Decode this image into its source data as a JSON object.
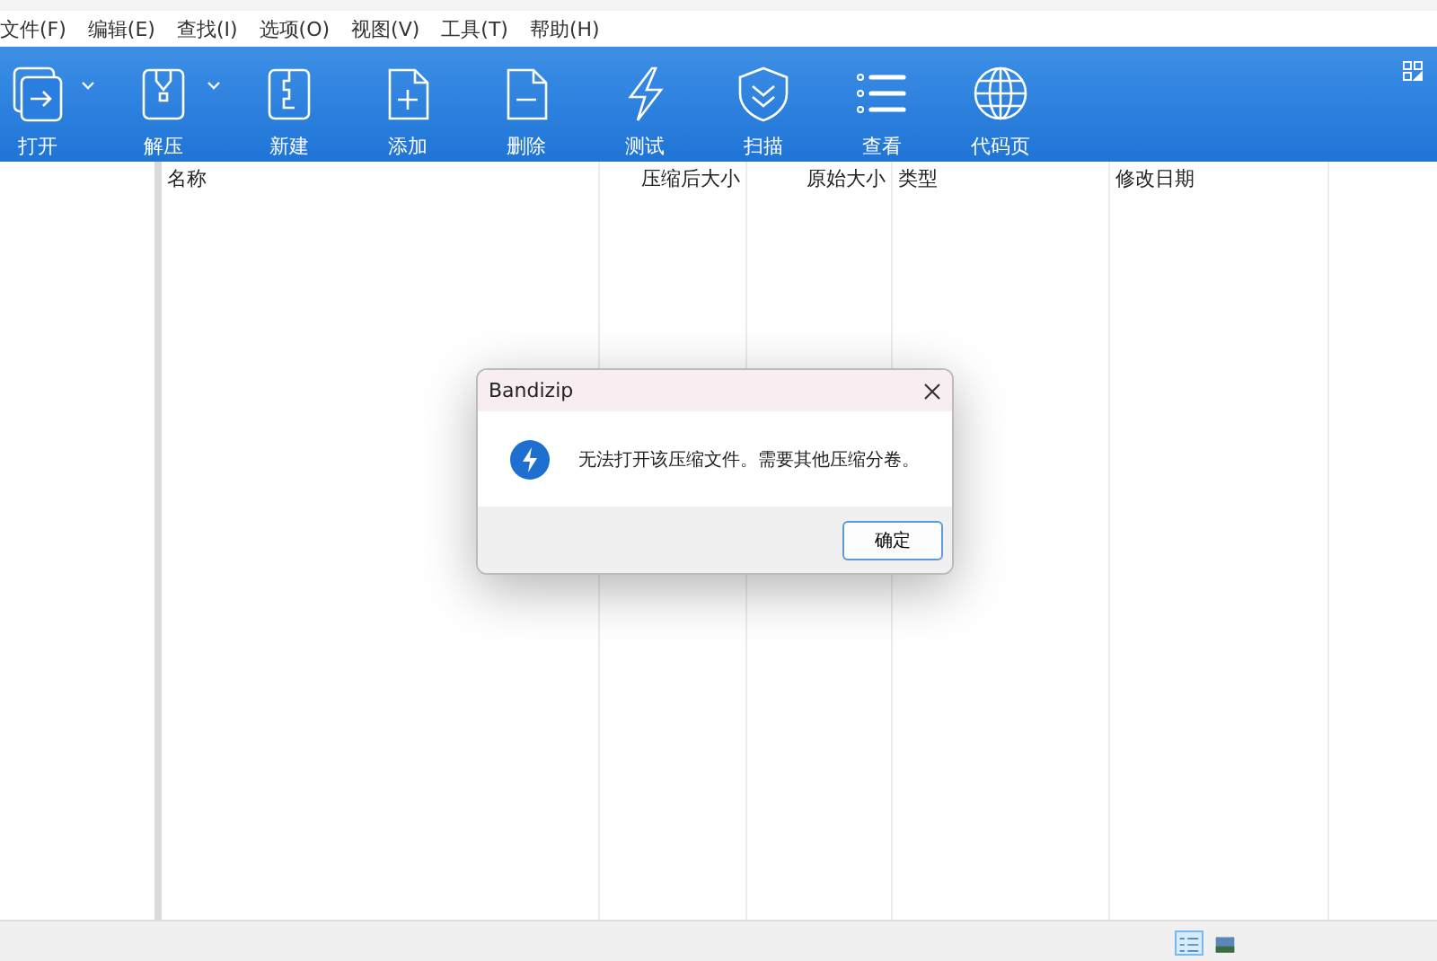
{
  "menu": [
    "文件(F)",
    "编辑(E)",
    "查找(I)",
    "选项(O)",
    "视图(V)",
    "工具(T)",
    "帮助(H)"
  ],
  "toolbar": [
    {
      "label": "打开",
      "kind": "split"
    },
    {
      "label": "解压",
      "kind": "split"
    },
    {
      "label": "新建",
      "kind": "plain"
    },
    {
      "label": "添加",
      "kind": "plain"
    },
    {
      "label": "删除",
      "kind": "plain"
    },
    {
      "label": "测试",
      "kind": "plain"
    },
    {
      "label": "扫描",
      "kind": "plain"
    },
    {
      "label": "查看",
      "kind": "plain"
    },
    {
      "label": "代码页",
      "kind": "plain"
    }
  ],
  "table": {
    "columns": [
      {
        "label": "名称"
      },
      {
        "label": "压缩后大小"
      },
      {
        "label": "原始大小"
      },
      {
        "label": "类型"
      },
      {
        "label": "修改日期"
      }
    ]
  },
  "dialog": {
    "title": "Bandizip",
    "message": "无法打开该压缩文件。需要其他压缩分卷。",
    "button": "确定"
  },
  "status_bar": {
    "view_buttons": [
      {
        "kind": "details",
        "selected": true
      },
      {
        "kind": "thumbnails",
        "selected": false
      }
    ]
  }
}
